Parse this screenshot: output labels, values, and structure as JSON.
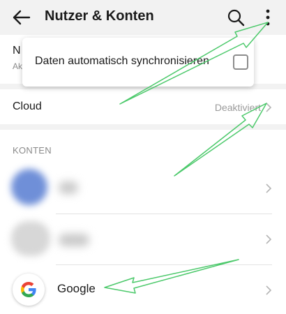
{
  "appbar": {
    "title": "Nutzer & Konten",
    "back_icon": "arrow-left-icon",
    "search_icon": "search-icon",
    "more_icon": "more-vert-icon",
    "background": "#f2f2f2"
  },
  "hidden_row": {
    "title_fragment": "N",
    "subtitle_fragment": "Ak"
  },
  "popup": {
    "item_label": "Daten automatisch synchronisieren",
    "checked": false
  },
  "cloud": {
    "label": "Cloud",
    "status": "Deaktiviert"
  },
  "accounts_section": {
    "header": "KONTEN",
    "items": [
      {
        "label": "",
        "blurred": true,
        "avatar_color": "#6f8fd8"
      },
      {
        "label": "",
        "blurred": true,
        "avatar_color": "#d7d7d7"
      },
      {
        "label": "Google",
        "blurred": false,
        "icon": "google-g-icon"
      }
    ]
  },
  "annotation": {
    "arrow_color": "#4cc96b"
  }
}
